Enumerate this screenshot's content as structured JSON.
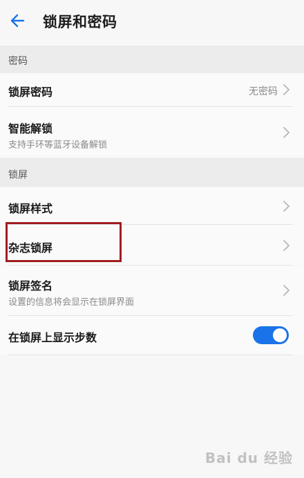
{
  "header": {
    "title": "锁屏和密码"
  },
  "sections": {
    "password": {
      "label": "密码"
    },
    "lockscreen": {
      "label": "锁屏"
    }
  },
  "rows": {
    "lock_password": {
      "title": "锁屏密码",
      "value": "无密码"
    },
    "smart_unlock": {
      "title": "智能解锁",
      "subtitle": "支持手环等蓝牙设备解锁"
    },
    "lock_style": {
      "title": "锁屏样式"
    },
    "magazine_lock": {
      "title": "杂志锁屏"
    },
    "lock_signature": {
      "title": "锁屏签名",
      "subtitle": "设置的信息将会显示在锁屏界面"
    },
    "show_steps": {
      "title": "在锁屏上显示步数",
      "enabled": true
    }
  },
  "watermark": "Bai du 经验",
  "colors": {
    "accent": "#1a73e8",
    "highlight": "#a01c22"
  }
}
